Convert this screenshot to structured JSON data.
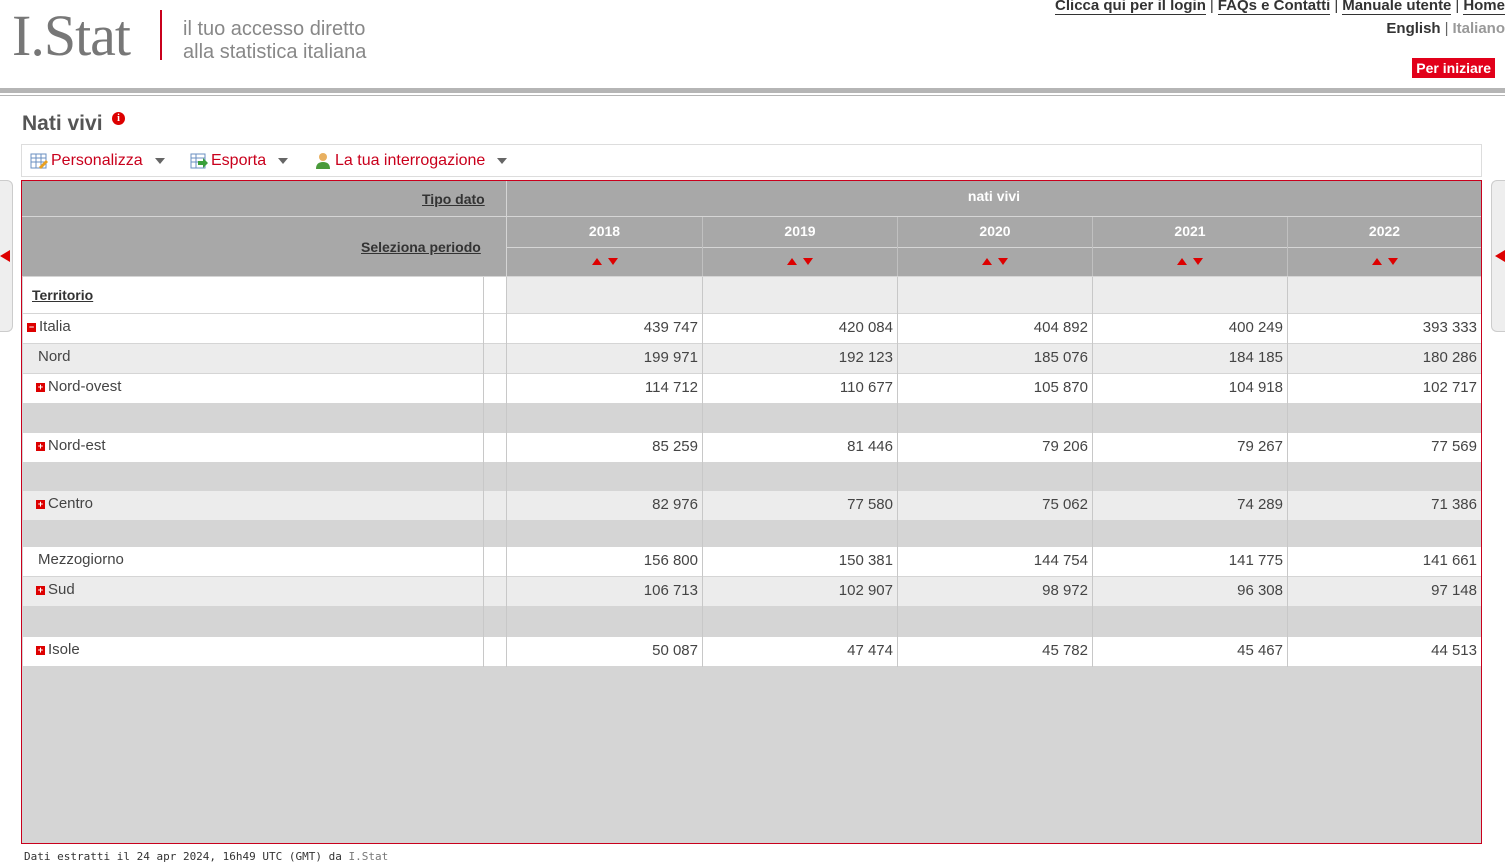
{
  "header": {
    "logo": "I.Stat",
    "tagline_line1": "il tuo accesso diretto",
    "tagline_line2": "alla statistica italiana",
    "links": [
      "Clicca qui per il login",
      "FAQs e Contatti",
      "Manuale utente",
      "Home"
    ],
    "lang_en": "English",
    "lang_it": "Italiano",
    "start_button": "Per iniziare"
  },
  "page": {
    "title": "Nati vivi",
    "info_icon": "i"
  },
  "toolbar": {
    "customize": "Personalizza",
    "export": "Esporta",
    "query": "La tua interrogazione"
  },
  "table": {
    "tipo_dato_label": "Tipo dato",
    "tipo_dato_value": "nati vivi",
    "periodo_label": "Seleziona periodo",
    "territorio_label": "Territorio",
    "years": [
      "2018",
      "2019",
      "2020",
      "2021",
      "2022"
    ],
    "rows": [
      {
        "name": "Italia",
        "toggle": "minus",
        "values": [
          "439 747",
          "420 084",
          "404 892",
          "400 249",
          "393 333"
        ]
      },
      {
        "name": "Nord",
        "toggle": "none",
        "values": [
          "199 971",
          "192 123",
          "185 076",
          "184 185",
          "180 286"
        ]
      },
      {
        "name": "Nord-ovest",
        "toggle": "plus",
        "values": [
          "114 712",
          "110 677",
          "105 870",
          "104 918",
          "102 717"
        ]
      },
      {
        "name": "Nord-est",
        "toggle": "plus",
        "values": [
          "85 259",
          "81 446",
          "79 206",
          "79 267",
          "77 569"
        ]
      },
      {
        "name": "Centro",
        "toggle": "plus",
        "values": [
          "82 976",
          "77 580",
          "75 062",
          "74 289",
          "71 386"
        ]
      },
      {
        "name": "Mezzogiorno",
        "toggle": "none",
        "values": [
          "156 800",
          "150 381",
          "144 754",
          "141 775",
          "141 661"
        ]
      },
      {
        "name": "Sud",
        "toggle": "plus",
        "values": [
          "106 713",
          "102 907",
          "98 972",
          "96 308",
          "97 148"
        ]
      },
      {
        "name": "Isole",
        "toggle": "plus",
        "values": [
          "50 087",
          "47 474",
          "45 782",
          "45 467",
          "44 513"
        ]
      }
    ]
  },
  "footer": {
    "text": "Dati estratti il 24 apr 2024, 16h49 UTC (GMT) da ",
    "source": "I.Stat"
  },
  "colors": {
    "accent": "#c9001c",
    "header_gray": "#a8a8a8",
    "body_gray": "#d5d5d5"
  }
}
